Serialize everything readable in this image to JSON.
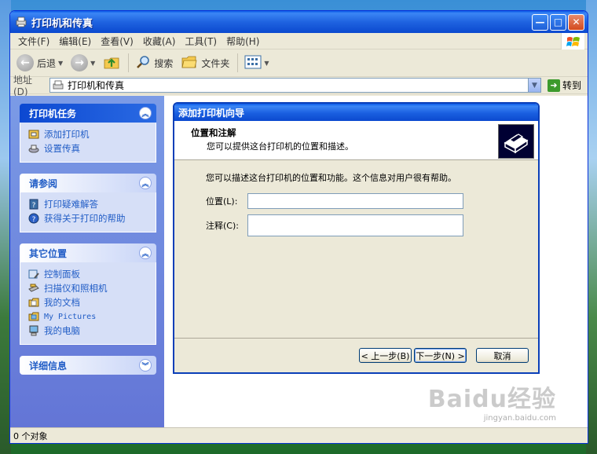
{
  "window": {
    "title": "打印机和传真",
    "min_symbol": "—",
    "max_symbol": "□",
    "close_symbol": "✕"
  },
  "menu": [
    "文件(F)",
    "编辑(E)",
    "查看(V)",
    "收藏(A)",
    "工具(T)",
    "帮助(H)"
  ],
  "toolbar": {
    "back_label": "后退",
    "search_label": "搜索",
    "folders_label": "文件夹"
  },
  "address": {
    "label": "地址(D)",
    "value": "打印机和传真",
    "go_label": "转到"
  },
  "sidebar": {
    "panels": [
      {
        "title": "打印机任务",
        "links": [
          {
            "label": "添加打印机",
            "icon": "add-printer-icon"
          },
          {
            "label": "设置传真",
            "icon": "fax-icon"
          }
        ]
      },
      {
        "title": "请参阅",
        "links": [
          {
            "label": "打印疑难解答",
            "icon": "help-book-icon"
          },
          {
            "label": "获得关于打印的帮助",
            "icon": "help-icon"
          }
        ]
      },
      {
        "title": "其它位置",
        "links": [
          {
            "label": "控制面板",
            "icon": "control-panel-icon"
          },
          {
            "label": "扫描仪和照相机",
            "icon": "scanner-icon"
          },
          {
            "label": "我的文档",
            "icon": "my-documents-icon"
          },
          {
            "label": "My Pictures",
            "icon": "my-pictures-icon"
          },
          {
            "label": "我的电脑",
            "icon": "my-computer-icon"
          }
        ]
      },
      {
        "title": "详细信息",
        "links": []
      }
    ]
  },
  "wizard": {
    "title": "添加打印机向导",
    "header_title": "位置和注解",
    "header_subtitle": "您可以提供这台打印机的位置和描述。",
    "description": "您可以描述这台打印机的位置和功能。这个信息对用户很有帮助。",
    "location_label": "位置(L):",
    "comment_label": "注释(C):",
    "location_value": "",
    "comment_value": "",
    "back_button": "< 上一步(B)",
    "next_button": "下一步(N) >",
    "cancel_button": "取消"
  },
  "status": {
    "text": "0 个对象"
  },
  "watermark": {
    "brand": "Baidu经验",
    "url": "jingyan.baidu.com"
  }
}
